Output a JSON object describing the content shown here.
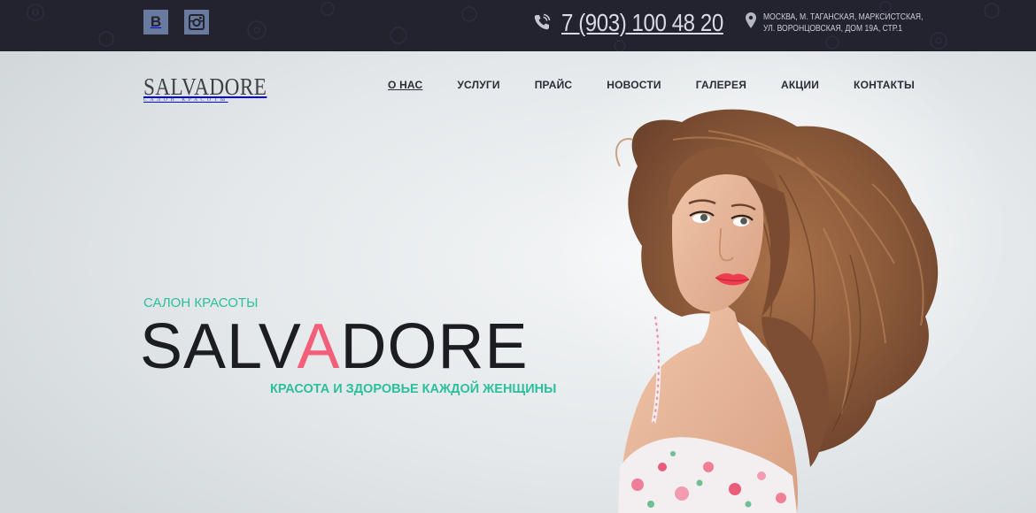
{
  "topbar": {
    "socials": [
      {
        "name": "vk",
        "glyph": "В"
      },
      {
        "name": "instagram"
      }
    ],
    "phone": "7 (903) 100 48 20",
    "address_line1": "МОСКВА, М. ТАГАНСКАЯ, МАРКСИСТСКАЯ,",
    "address_line2": "УЛ. ВОРОНЦОВСКАЯ, ДОМ 19А, СТР.1"
  },
  "logo": {
    "main": "SALVADORE",
    "sub": "САЛОН КРАСОТЫ"
  },
  "nav": {
    "items": [
      {
        "label": "О НАС"
      },
      {
        "label": "УСЛУГИ"
      },
      {
        "label": "ПРАЙС"
      },
      {
        "label": "НОВОСТИ"
      },
      {
        "label": "ГАЛЕРЕЯ"
      },
      {
        "label": "АКЦИИ"
      },
      {
        "label": "КОНТАКТЫ"
      }
    ]
  },
  "hero": {
    "kicker": "САЛОН КРАСОТЫ",
    "brand_pre": "SALV",
    "brand_accent": "A",
    "brand_post": "DORE",
    "tagline": "КРАСОТА И ЗДОРОВЬЕ КАЖДОЙ ЖЕНЩИНЫ"
  },
  "colors": {
    "topbar_bg": "#22232f",
    "accent_teal": "#2bbf9c",
    "accent_pink": "#f35f78",
    "text_dark": "#1c1d22",
    "social_bg": "#6a7a9f"
  }
}
